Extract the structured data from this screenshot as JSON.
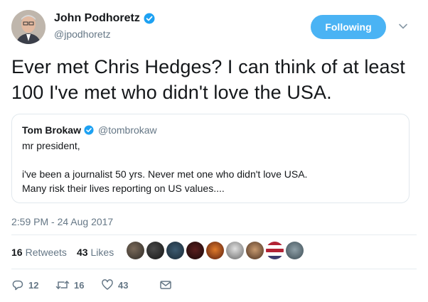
{
  "author": {
    "name": "John Podhoretz",
    "handle": "@jpodhoretz",
    "verified": true
  },
  "follow_button": {
    "label": "Following"
  },
  "tweet": {
    "text": "Ever met Chris Hedges? I can think of at least 100 I've met who didn't love the USA.",
    "timestamp": "2:59 PM - 24 Aug 2017"
  },
  "quoted_tweet": {
    "name": "Tom Brokaw",
    "handle": "@tombrokaw",
    "verified": true,
    "text": "mr president,\n\ni've been a journalist 50 yrs. Never met one who didn't love USA.\nMany risk  their lives reporting on US values...."
  },
  "stats": {
    "retweets_count": "16",
    "retweets_label": "Retweets",
    "likes_count": "43",
    "likes_label": "Likes"
  },
  "actions": {
    "reply_count": "12",
    "retweet_count": "16",
    "like_count": "43"
  },
  "colors": {
    "accent": "#4ab3f4",
    "verified": "#1da1f2",
    "muted": "#657786"
  },
  "icons": [
    "verified-badge-icon",
    "chevron-down-icon",
    "reply-icon",
    "retweet-icon",
    "heart-icon",
    "message-icon"
  ]
}
